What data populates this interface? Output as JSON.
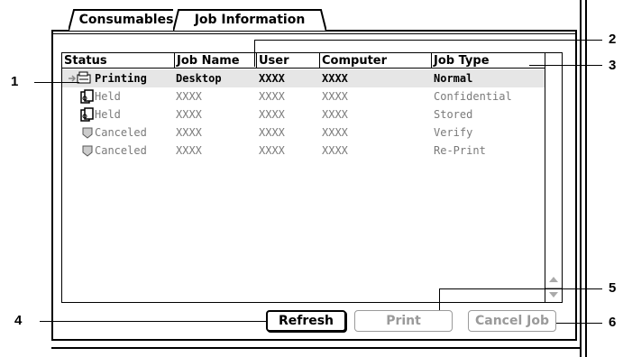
{
  "tabs": [
    {
      "label": "Consumables",
      "active": false
    },
    {
      "label": "Job Information",
      "active": true
    }
  ],
  "table": {
    "columns": [
      "Status",
      "Job Name",
      "User",
      "Computer",
      "Job Type"
    ],
    "rows": [
      {
        "status": "Printing",
        "icon": "printer-icon",
        "job_name": "Desktop",
        "user": "XXXX",
        "computer": "XXXX",
        "job_type": "Normal",
        "selected": true
      },
      {
        "status": "Held",
        "icon": "held-document-icon",
        "job_name": "XXXX",
        "user": "XXXX",
        "computer": "XXXX",
        "job_type": "Confidential",
        "selected": false
      },
      {
        "status": "Held",
        "icon": "held-document-icon",
        "job_name": "XXXX",
        "user": "XXXX",
        "computer": "XXXX",
        "job_type": "Stored",
        "selected": false
      },
      {
        "status": "Canceled",
        "icon": "canceled-icon",
        "job_name": "XXXX",
        "user": "XXXX",
        "computer": "XXXX",
        "job_type": "Verify",
        "selected": false
      },
      {
        "status": "Canceled",
        "icon": "canceled-icon",
        "job_name": "XXXX",
        "user": "XXXX",
        "computer": "XXXX",
        "job_type": "Re-Print",
        "selected": false
      }
    ]
  },
  "buttons": {
    "refresh": "Refresh",
    "print": "Print",
    "cancel_job": "Cancel Job"
  },
  "callouts": {
    "c1": "1",
    "c2": "2",
    "c3": "3",
    "c4": "4",
    "c5": "5",
    "c6": "6"
  },
  "colors": {
    "selected_row": "#e6e6e6",
    "disabled_text": "#9a9a9a",
    "dim_text": "#7a7a7a"
  }
}
